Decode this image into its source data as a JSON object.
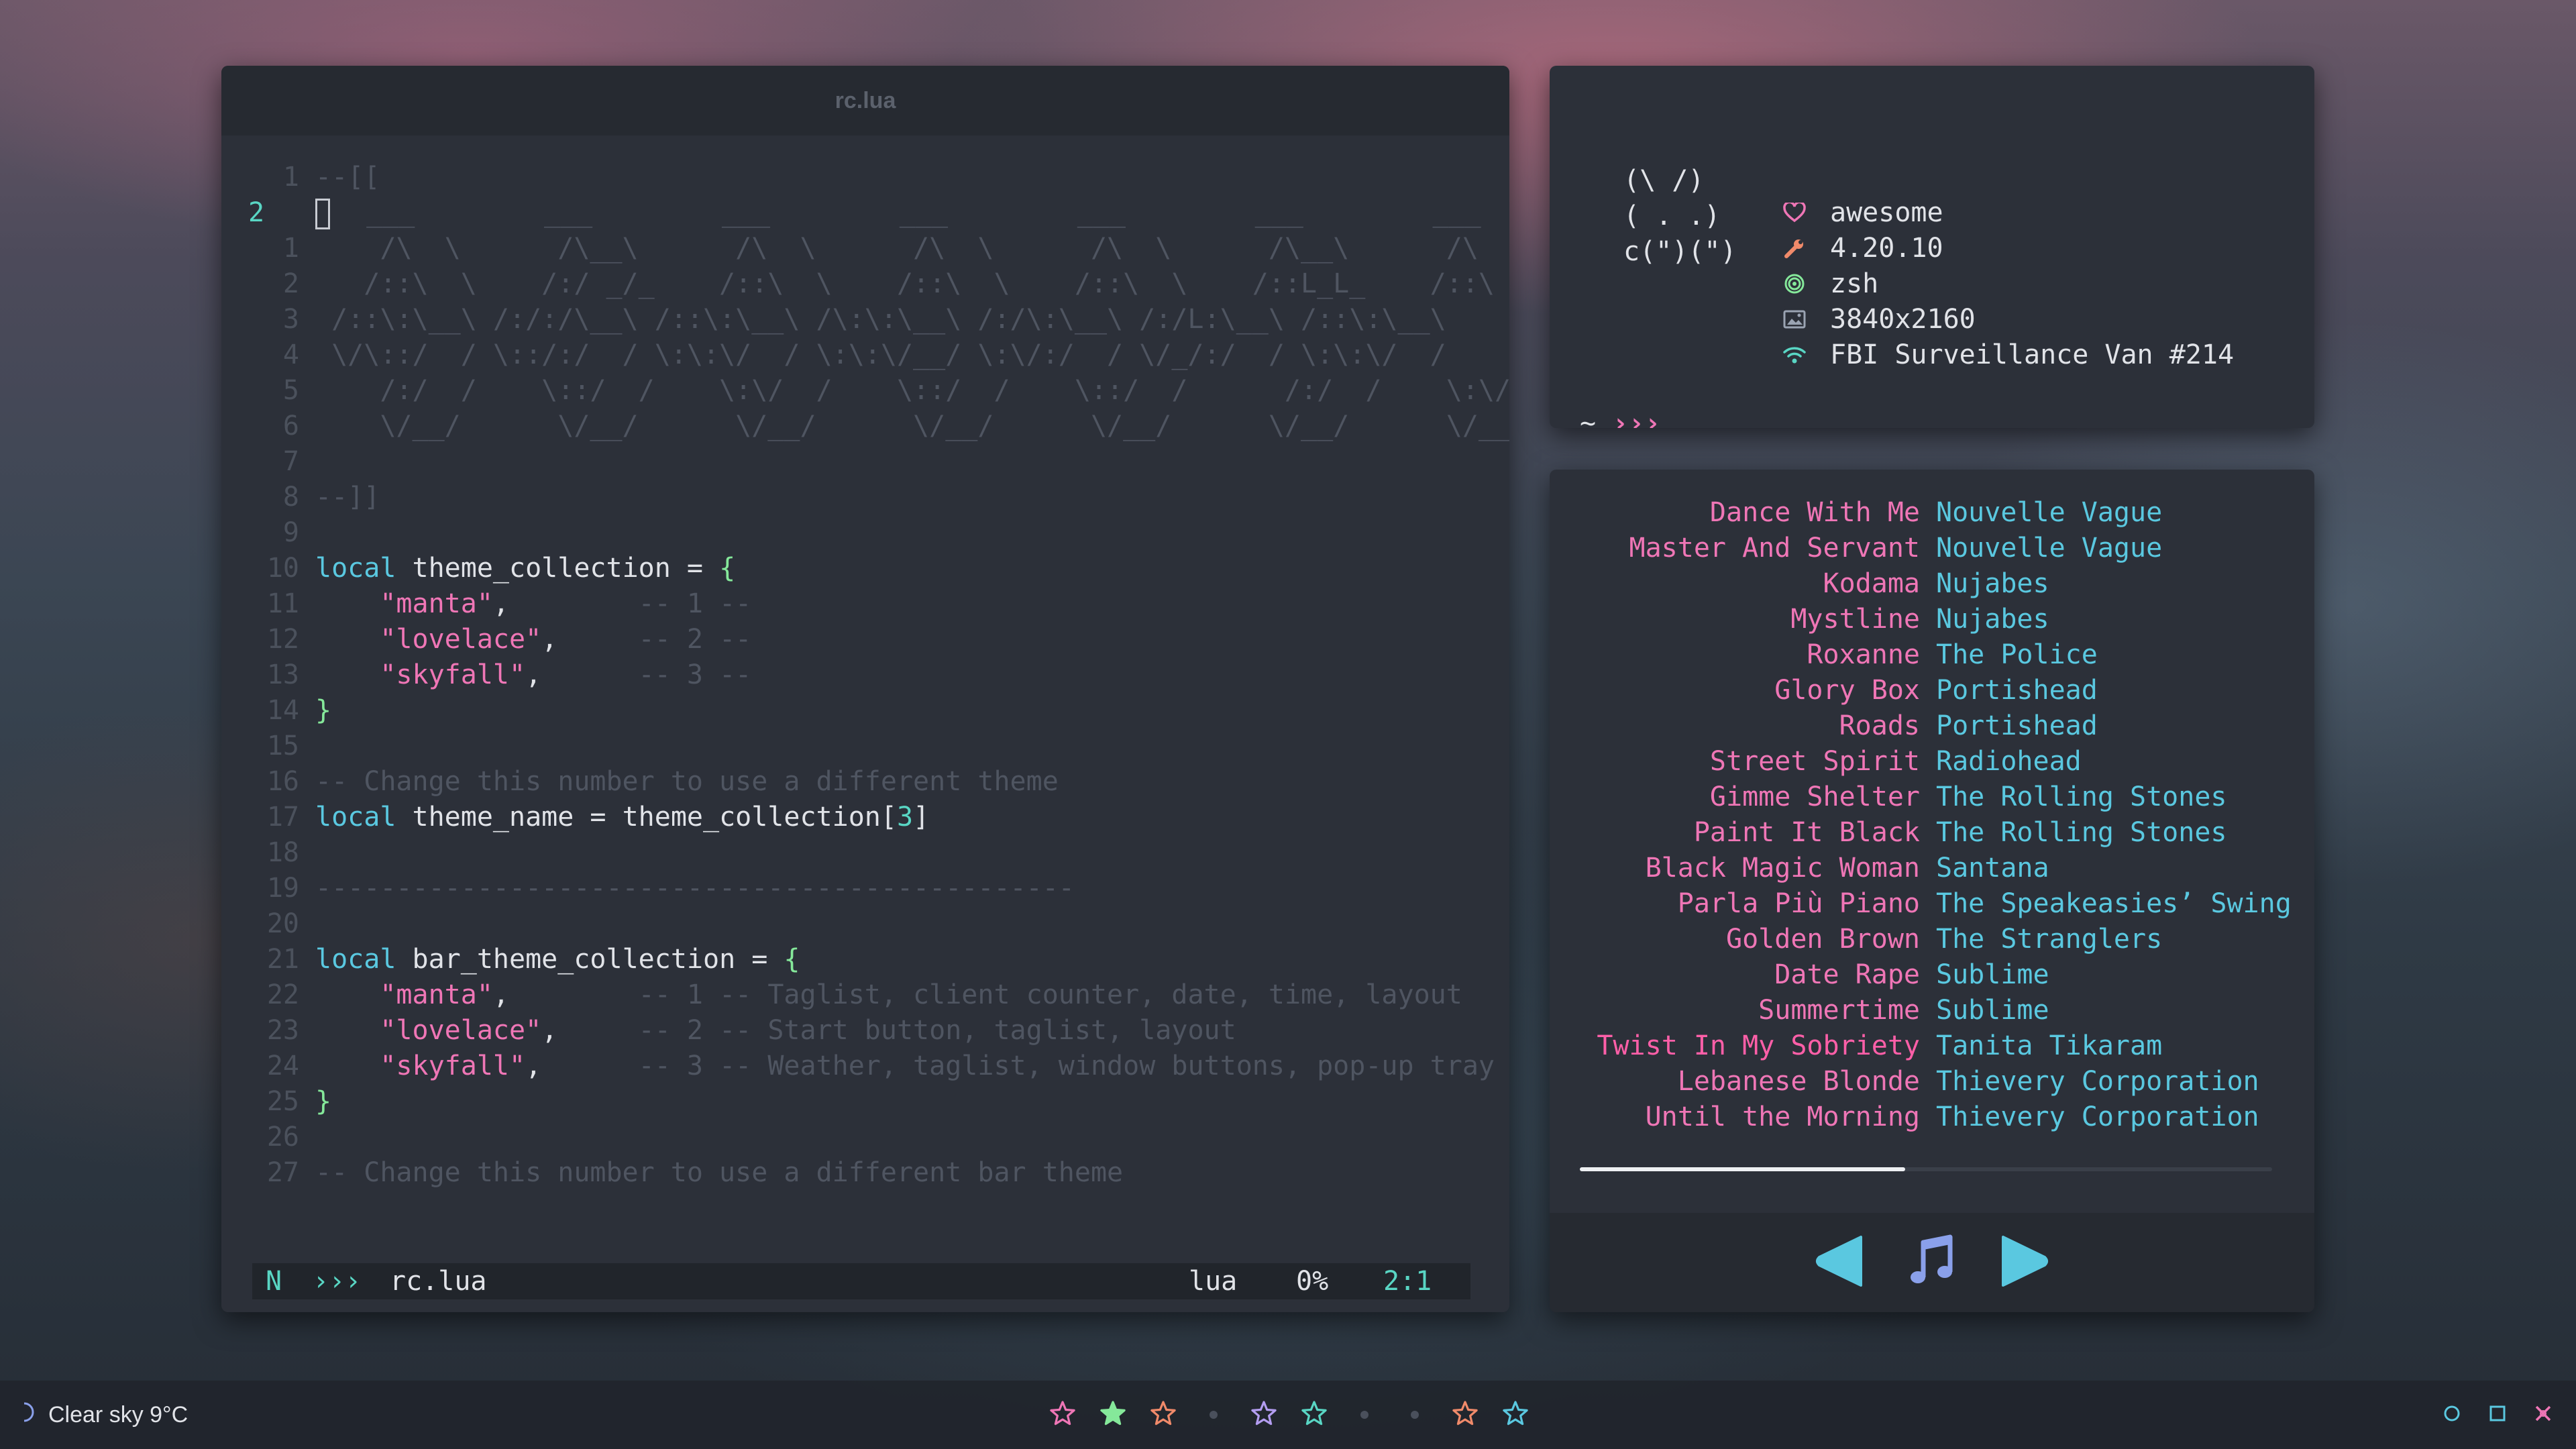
{
  "editor": {
    "title": "rc.lua",
    "lines": [
      {
        "n": "1",
        "segs": [
          {
            "c": "cmt",
            "t": "--[["
          }
        ]
      },
      {
        "n": "2",
        "current": true,
        "cursor": true,
        "segs": [
          {
            "c": "cmt",
            "t": " ___        ___        ___        ___        ___        ___        ___"
          }
        ]
      },
      {
        "n": "1",
        "segs": [
          {
            "c": "cmt",
            "t": "    /\\  \\      /\\__\\      /\\  \\      /\\  \\      /\\  \\      /\\__\\      /\\  \\"
          }
        ]
      },
      {
        "n": "2",
        "segs": [
          {
            "c": "cmt",
            "t": "   /::\\  \\    /:/ _/_    /::\\  \\    /::\\  \\    /::\\  \\    /::L_L_    /::\\  \\"
          }
        ]
      },
      {
        "n": "3",
        "segs": [
          {
            "c": "cmt",
            "t": " /::\\:\\__\\ /:/:/\\__\\ /::\\:\\__\\ /\\:\\:\\__\\ /:/\\:\\__\\ /:/L:\\__\\ /::\\:\\__\\"
          }
        ]
      },
      {
        "n": "4",
        "segs": [
          {
            "c": "cmt",
            "t": " \\/\\::/  / \\::/:/  / \\:\\:\\/  / \\:\\:\\/__/ \\:\\/:/  / \\/_/:/  / \\:\\:\\/  /"
          }
        ]
      },
      {
        "n": "5",
        "segs": [
          {
            "c": "cmt",
            "t": "    /:/  /    \\::/  /    \\:\\/  /    \\::/  /    \\::/  /      /:/  /    \\:\\/  /"
          }
        ]
      },
      {
        "n": "6",
        "segs": [
          {
            "c": "cmt",
            "t": "    \\/__/      \\/__/      \\/__/      \\/__/      \\/__/      \\/__/      \\/__/"
          }
        ]
      },
      {
        "n": "7",
        "segs": []
      },
      {
        "n": "8",
        "segs": [
          {
            "c": "cmt",
            "t": "--]]"
          }
        ]
      },
      {
        "n": "9",
        "segs": []
      },
      {
        "n": "10",
        "segs": [
          {
            "c": "kw",
            "t": "local"
          },
          {
            "c": "",
            "t": " theme_collection = "
          },
          {
            "c": "brace",
            "t": "{"
          }
        ]
      },
      {
        "n": "11",
        "segs": [
          {
            "c": "",
            "t": "    "
          },
          {
            "c": "str",
            "t": "\"manta\""
          },
          {
            "c": "",
            "t": ",        "
          },
          {
            "c": "cmt",
            "t": "-- 1 --"
          }
        ]
      },
      {
        "n": "12",
        "segs": [
          {
            "c": "",
            "t": "    "
          },
          {
            "c": "str",
            "t": "\"lovelace\""
          },
          {
            "c": "",
            "t": ",     "
          },
          {
            "c": "cmt",
            "t": "-- 2 --"
          }
        ]
      },
      {
        "n": "13",
        "segs": [
          {
            "c": "",
            "t": "    "
          },
          {
            "c": "str",
            "t": "\"skyfall\""
          },
          {
            "c": "",
            "t": ",      "
          },
          {
            "c": "cmt",
            "t": "-- 3 --"
          }
        ]
      },
      {
        "n": "14",
        "segs": [
          {
            "c": "brace",
            "t": "}"
          }
        ]
      },
      {
        "n": "15",
        "segs": []
      },
      {
        "n": "16",
        "segs": [
          {
            "c": "cmt",
            "t": "-- Change this number to use a different theme"
          }
        ]
      },
      {
        "n": "17",
        "segs": [
          {
            "c": "kw",
            "t": "local"
          },
          {
            "c": "",
            "t": " theme_name = theme_collection["
          },
          {
            "c": "num",
            "t": "3"
          },
          {
            "c": "",
            "t": "]"
          }
        ]
      },
      {
        "n": "18",
        "segs": []
      },
      {
        "n": "19",
        "segs": [
          {
            "c": "cmt",
            "t": "-----------------------------------------------"
          }
        ]
      },
      {
        "n": "20",
        "segs": []
      },
      {
        "n": "21",
        "segs": [
          {
            "c": "kw",
            "t": "local"
          },
          {
            "c": "",
            "t": " bar_theme_collection = "
          },
          {
            "c": "brace",
            "t": "{"
          }
        ]
      },
      {
        "n": "22",
        "segs": [
          {
            "c": "",
            "t": "    "
          },
          {
            "c": "str",
            "t": "\"manta\""
          },
          {
            "c": "",
            "t": ",        "
          },
          {
            "c": "cmt",
            "t": "-- 1 -- Taglist, client counter, date, time, layout"
          }
        ]
      },
      {
        "n": "23",
        "segs": [
          {
            "c": "",
            "t": "    "
          },
          {
            "c": "str",
            "t": "\"lovelace\""
          },
          {
            "c": "",
            "t": ",     "
          },
          {
            "c": "cmt",
            "t": "-- 2 -- Start button, taglist, layout"
          }
        ]
      },
      {
        "n": "24",
        "segs": [
          {
            "c": "",
            "t": "    "
          },
          {
            "c": "str",
            "t": "\"skyfall\""
          },
          {
            "c": "",
            "t": ",      "
          },
          {
            "c": "cmt",
            "t": "-- 3 -- Weather, taglist, window buttons, pop-up tray"
          }
        ]
      },
      {
        "n": "25",
        "segs": [
          {
            "c": "brace",
            "t": "}"
          }
        ]
      },
      {
        "n": "26",
        "segs": []
      },
      {
        "n": "27",
        "segs": [
          {
            "c": "cmt",
            "t": "-- Change this number to use a different bar theme"
          }
        ]
      }
    ],
    "status": {
      "mode": "N",
      "arrows": "›››",
      "file": "rc.lua",
      "filetype": "lua",
      "percent": "0%",
      "position": "2:1"
    }
  },
  "fetch": {
    "ascii": [
      "(\\ /)",
      "( . .)",
      "c(\")(\")"
    ],
    "info": [
      {
        "icon": "heart-icon",
        "value": "awesome",
        "color": "#ef76b6"
      },
      {
        "icon": "wrench-icon",
        "value": "4.20.10",
        "color": "#f08a6a"
      },
      {
        "icon": "spiral-icon",
        "value": "zsh",
        "color": "#85e89a"
      },
      {
        "icon": "image-icon",
        "value": "3840x2160",
        "color": "#9aa3b2"
      },
      {
        "icon": "wifi-icon",
        "value": "FBI Surveillance Van #214",
        "color": "#59d6c4"
      }
    ],
    "prompt": {
      "tilde": "~",
      "arrows": "›››",
      "cursor": "_"
    }
  },
  "music": {
    "tracks": [
      {
        "title": "Dance With Me",
        "artist": "Nouvelle Vague"
      },
      {
        "title": "Master And Servant",
        "artist": "Nouvelle Vague"
      },
      {
        "title": "Kodama",
        "artist": "Nujabes"
      },
      {
        "title": "Mystline",
        "artist": "Nujabes"
      },
      {
        "title": "Roxanne",
        "artist": "The Police"
      },
      {
        "title": "Glory Box",
        "artist": "Portishead"
      },
      {
        "title": "Roads",
        "artist": "Portishead"
      },
      {
        "title": "Street Spirit",
        "artist": "Radiohead"
      },
      {
        "title": "Gimme Shelter",
        "artist": "The Rolling Stones"
      },
      {
        "title": "Paint It Black",
        "artist": "The Rolling Stones"
      },
      {
        "title": "Black Magic Woman",
        "artist": "Santana"
      },
      {
        "title": "Parla Più Piano",
        "artist": "The Speakeasies’ Swing"
      },
      {
        "title": "Golden Brown",
        "artist": "The Stranglers"
      },
      {
        "title": "Date Rape",
        "artist": "Sublime"
      },
      {
        "title": "Summertime",
        "artist": "Sublime"
      },
      {
        "title": "Twist In My Sobriety",
        "artist": "Tanita Tikaram",
        "active": true
      },
      {
        "title": "Lebanese Blonde",
        "artist": "Thievery Corporation"
      },
      {
        "title": "Until the Morning",
        "artist": "Thievery Corporation"
      }
    ],
    "progress": 0.47,
    "controls": [
      {
        "icon": "previous-icon",
        "color": "#5ac8e0"
      },
      {
        "icon": "music-note-icon",
        "color": "#8aa0ea"
      },
      {
        "icon": "next-icon",
        "color": "#5ac8e0"
      }
    ]
  },
  "bar": {
    "weather": {
      "icon": "moon-icon",
      "text": "Clear sky 9°C"
    },
    "tags": [
      {
        "kind": "star",
        "color": "#ef76b6",
        "filled": false
      },
      {
        "kind": "star",
        "color": "#85e89a",
        "filled": true
      },
      {
        "kind": "star",
        "color": "#f08a6a",
        "filled": false
      },
      {
        "kind": "dot"
      },
      {
        "kind": "star",
        "color": "#b39df0",
        "filled": false
      },
      {
        "kind": "star",
        "color": "#59d6c4",
        "filled": false
      },
      {
        "kind": "dot"
      },
      {
        "kind": "dot"
      },
      {
        "kind": "star",
        "color": "#f08a6a",
        "filled": false
      },
      {
        "kind": "star",
        "color": "#5ac8e0",
        "filled": false
      }
    ],
    "window_buttons": [
      {
        "icon": "minimize-icon",
        "color": "#5ac8e0"
      },
      {
        "icon": "maximize-icon",
        "color": "#5ac8e0"
      },
      {
        "icon": "close-icon",
        "color": "#ef76b6"
      }
    ]
  }
}
